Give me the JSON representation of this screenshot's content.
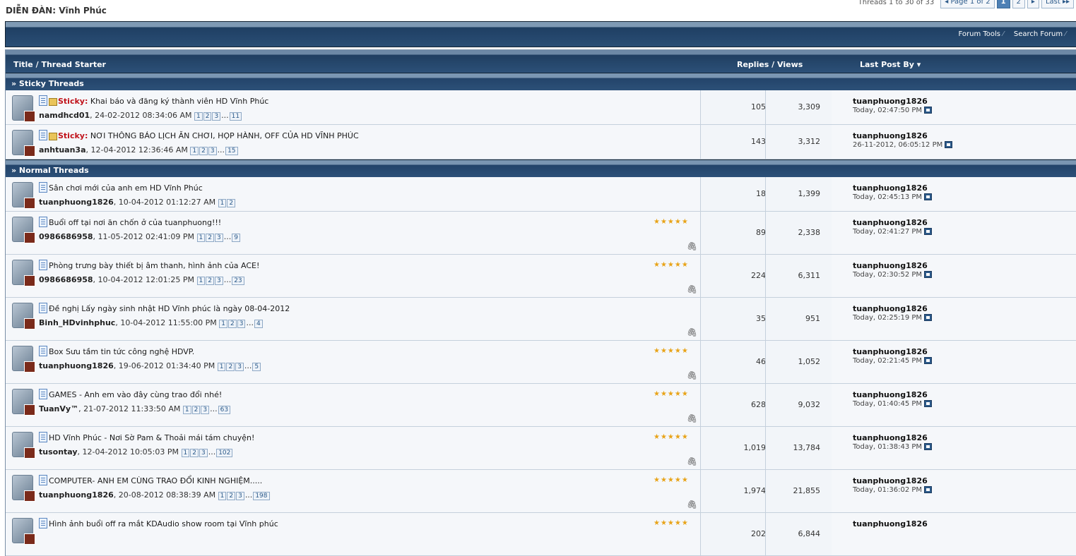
{
  "forum_title": "DIỄN ĐÀN: Vĩnh Phúc",
  "pagenav": {
    "summary": "Threads 1 to 30 of 33",
    "prev": "◂ Page 1 of 2",
    "pages": [
      "1",
      "2"
    ],
    "next": "▸",
    "last": "Last ▸▸"
  },
  "toolbar": {
    "forum_tools": "Forum Tools",
    "search_forum": "Search Forum"
  },
  "columns": {
    "title": "Title / Thread Starter",
    "replies_views": "Replies / Views",
    "last_post": "Last Post By"
  },
  "sections": {
    "sticky": "» Sticky Threads",
    "normal": "» Normal Threads"
  },
  "sticky_label": "Sticky:",
  "sticky_threads": [
    {
      "title": "Khai báo và đăng ký thành viên HD Vĩnh Phúc",
      "starter": "namdhcd01",
      "date": ", 24-02-2012 08:34:06 AM",
      "pages": [
        "1",
        "2",
        "3"
      ],
      "last_page": "11",
      "replies": "105",
      "views": "3,309",
      "last_user": "tuanphuong1826",
      "last_time": "Today, 02:47:50 PM"
    },
    {
      "title": "NƠI THÔNG BÁO LỊCH ĂN CHƠI, HỌP HÀNH, OFF CỦA HD VĨNH PHÚC",
      "starter": "anhtuan3a",
      "date": ", 12-04-2012 12:36:46 AM",
      "pages": [
        "1",
        "2",
        "3"
      ],
      "last_page": "15",
      "replies": "143",
      "views": "3,312",
      "last_user": "tuanphuong1826",
      "last_time": "26-11-2012, 06:05:12 PM"
    }
  ],
  "normal_threads": [
    {
      "title": "Sân chơi mới của anh em HD Vĩnh Phúc",
      "starter": "tuanphuong1826",
      "date": ", 10-04-2012 01:12:27 AM",
      "pages": [
        "1",
        "2"
      ],
      "last_page": "",
      "rating": false,
      "attachment": false,
      "replies": "18",
      "views": "1,399",
      "last_user": "tuanphuong1826",
      "last_time": "Today, 02:45:13 PM"
    },
    {
      "title": "Buổi off tại nơi ăn chốn ở của tuanphuong!!!",
      "starter": "0986686958",
      "date": ", 11-05-2012 02:41:09 PM",
      "pages": [
        "1",
        "2",
        "3"
      ],
      "last_page": "9",
      "rating": true,
      "attachment": true,
      "replies": "89",
      "views": "2,338",
      "last_user": "tuanphuong1826",
      "last_time": "Today, 02:41:27 PM"
    },
    {
      "title": "Phòng trưng bày thiết bị âm thanh, hình ảnh của ACE!",
      "starter": "0986686958",
      "date": ", 10-04-2012 12:01:25 PM",
      "pages": [
        "1",
        "2",
        "3"
      ],
      "last_page": "23",
      "rating": true,
      "attachment": true,
      "replies": "224",
      "views": "6,311",
      "last_user": "tuanphuong1826",
      "last_time": "Today, 02:30:52 PM"
    },
    {
      "title": "Đề nghị Lấy ngày sinh nhật HD Vĩnh phúc là ngày 08-04-2012",
      "starter": "Binh_HDvinhphuc",
      "date": ", 10-04-2012 11:55:00 PM",
      "pages": [
        "1",
        "2",
        "3"
      ],
      "last_page": "4",
      "rating": false,
      "attachment": true,
      "replies": "35",
      "views": "951",
      "last_user": "tuanphuong1826",
      "last_time": "Today, 02:25:19 PM"
    },
    {
      "title": "Box Sưu tầm tin tức công nghệ HDVP.",
      "starter": "tuanphuong1826",
      "date": ", 19-06-2012 01:34:40 PM",
      "pages": [
        "1",
        "2",
        "3"
      ],
      "last_page": "5",
      "rating": true,
      "attachment": true,
      "replies": "46",
      "views": "1,052",
      "last_user": "tuanphuong1826",
      "last_time": "Today, 02:21:45 PM"
    },
    {
      "title": "GAMES - Anh em vào đây cùng trao đổi nhé!",
      "starter": "TuanVy™",
      "date": ", 21-07-2012 11:33:50 AM",
      "pages": [
        "1",
        "2",
        "3"
      ],
      "last_page": "63",
      "rating": true,
      "attachment": true,
      "replies": "628",
      "views": "9,032",
      "last_user": "tuanphuong1826",
      "last_time": "Today, 01:40:45 PM"
    },
    {
      "title": "HD Vĩnh Phúc - Nơi Sờ Pam & Thoải mái tám chuyện!",
      "starter": "tusontay",
      "date": ", 12-04-2012 10:05:03 PM",
      "pages": [
        "1",
        "2",
        "3"
      ],
      "last_page": "102",
      "rating": true,
      "attachment": true,
      "replies": "1,019",
      "views": "13,784",
      "last_user": "tuanphuong1826",
      "last_time": "Today, 01:38:43 PM"
    },
    {
      "title": "COMPUTER- ANH EM CÙNG TRAO ĐỔI KINH NGHIỆM.....",
      "starter": "tuanphuong1826",
      "date": ", 20-08-2012 08:38:39 AM",
      "pages": [
        "1",
        "2",
        "3"
      ],
      "last_page": "198",
      "rating": true,
      "attachment": true,
      "replies": "1,974",
      "views": "21,855",
      "last_user": "tuanphuong1826",
      "last_time": "Today, 01:36:02 PM"
    },
    {
      "title": "Hình ảnh buổi off ra mắt KDAudio show room tại Vĩnh phúc",
      "starter": "",
      "date": "",
      "pages": [],
      "last_page": "",
      "rating": true,
      "attachment": false,
      "replies": "202",
      "views": "6,844",
      "last_user": "tuanphuong1826",
      "last_time": ""
    }
  ],
  "rating_stars": "★★★★★",
  "attachment_glyph": "🖇",
  "dots": "..."
}
